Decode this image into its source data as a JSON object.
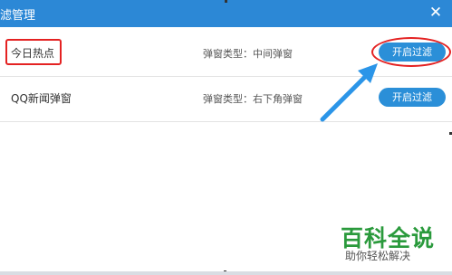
{
  "window": {
    "title": "滤管理"
  },
  "rows": [
    {
      "name": "今日热点",
      "popup_type": "弹窗类型：中间弹窗",
      "button": "开启过滤"
    },
    {
      "name": "QQ新闻弹窗",
      "popup_type": "弹窗类型：右下角弹窗",
      "button": "开启过滤"
    }
  ],
  "watermark": {
    "main": "百科全说",
    "sub": "助你轻松解决"
  },
  "colors": {
    "titlebar": "#2c88d6",
    "button": "#2b8fd8",
    "highlight": "#e42222",
    "arrow": "#2b95e8",
    "watermark": "#2a9a3c"
  }
}
